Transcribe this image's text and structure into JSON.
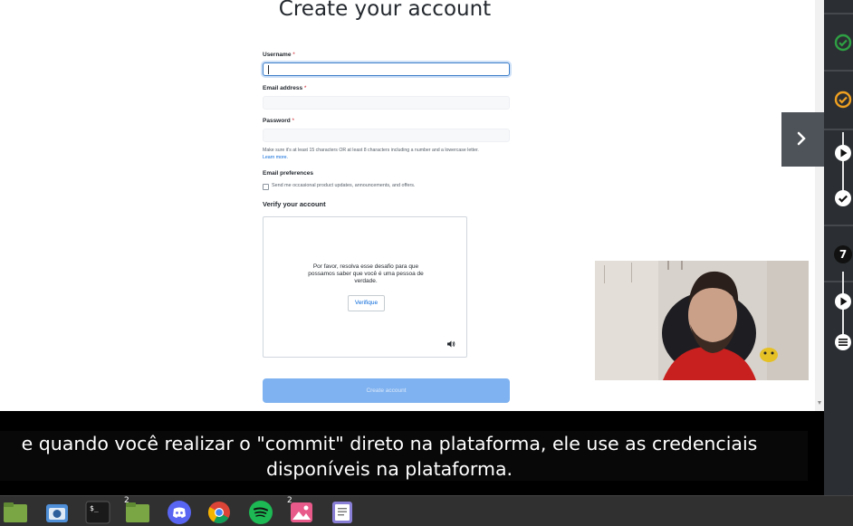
{
  "signup": {
    "title": "Create your account",
    "username_label": "Username",
    "email_label": "Email address",
    "password_label": "Password",
    "required_mark": "*",
    "password_hint": "Make sure it's at least 15 characters OR at least 8 characters including a number and a lowercase letter.",
    "learn_more": "Learn more.",
    "email_prefs_label": "Email preferences",
    "email_prefs_checkbox": "Send me occasional product updates, announcements, and offers.",
    "verify_title": "Verify your account",
    "captcha_text": "Por favor, resolva esse desafio para que possamos saber que você é uma pessoa de verdade.",
    "captcha_button": "Verifique",
    "create_button": "Create account"
  },
  "subtitles": {
    "line1": "e quando você realizar o \"commit\" direto na plataforma, ele use as credenciais",
    "line2": "disponíveis na plataforma."
  },
  "sidebar": {
    "lesson_number": "7",
    "colors": {
      "complete_green": "#2ea043",
      "inprogress_orange": "#f0a020",
      "background": "#2b2f33"
    }
  },
  "taskbar": {
    "apps": [
      {
        "name": "files-green-folder",
        "badge": ""
      },
      {
        "name": "screenshot-camera",
        "badge": ""
      },
      {
        "name": "terminal",
        "badge": ""
      },
      {
        "name": "files-folder",
        "badge": "2"
      },
      {
        "name": "discord",
        "badge": ""
      },
      {
        "name": "chrome",
        "badge": ""
      },
      {
        "name": "spotify",
        "badge": ""
      },
      {
        "name": "image-viewer",
        "badge": "2"
      },
      {
        "name": "text-editor",
        "badge": ""
      }
    ]
  }
}
